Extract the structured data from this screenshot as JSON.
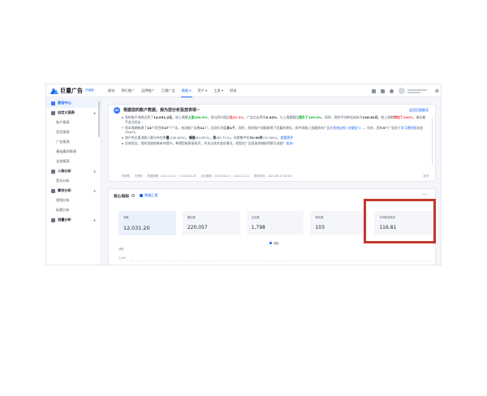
{
  "header": {
    "logo_text": "巨量广告",
    "logo_badge": "升级版",
    "nav": [
      {
        "label": "概览",
        "active": false
      },
      {
        "label": "预行推广",
        "active": false
      },
      {
        "label": "品牌推广",
        "active": false
      },
      {
        "label": "巨量广告",
        "active": false
      },
      {
        "label": "数据 ▾",
        "active": true
      },
      {
        "label": "资产 ▾",
        "active": false
      },
      {
        "label": "工具 ▾",
        "active": false
      },
      {
        "label": "财务",
        "active": false
      }
    ],
    "icons": [
      "calendar-icon",
      "message-icon",
      "help-icon",
      "avatar",
      "settings-icon"
    ]
  },
  "sidebar": {
    "items": [
      {
        "label": "报告中心",
        "type": "head-active"
      },
      {
        "label": "自定义报表",
        "type": "head"
      },
      {
        "label": "账户报表",
        "type": "sub"
      },
      {
        "label": "项目报表",
        "type": "sub"
      },
      {
        "label": "广告报表",
        "type": "sub"
      },
      {
        "label": "基础素材报表",
        "type": "sub"
      },
      {
        "label": "全部报表",
        "type": "sub"
      },
      {
        "label": "人群分析",
        "type": "head"
      },
      {
        "label": "受众分析",
        "type": "sub"
      },
      {
        "label": "素材分析",
        "type": "head"
      },
      {
        "label": "视频分析",
        "type": "sub"
      },
      {
        "label": "标题分析",
        "type": "sub"
      },
      {
        "label": "流量分析",
        "type": "head"
      }
    ]
  },
  "ai_card": {
    "logo": "AI",
    "title": "根据您的账户数据，我为您分析投放表现~",
    "link": "返回旧版解读",
    "b1": {
      "p1": "您的账户消耗达到了",
      "v1": "12,031.2元",
      "p2": "，较上周期",
      "v2": "上涨100.0%",
      "p3": "，但与同行相比",
      "v3": "低33.3%",
      "p4": "。广告点击率为",
      "v4": "0.42%",
      "p5": "，与上周期相比",
      "v5": "提升了100.0%",
      "p6": "，同时，您的平均转化成本为",
      "v6": "116.81元",
      "p7": "，较上周期",
      "v7": "增加了100%",
      "p8": "，建议着手关注优化~"
    },
    "b2": {
      "p1": "您本周期新建了",
      "v1": "13",
      "p2": "个项目和",
      "v2": "17",
      "p3": "个广告，有消耗广告数",
      "v3": "11",
      "p4": "个，比同行均值",
      "v4": "多1个",
      "p5": "。同时，您的账户消耗取得了显著的增长，其中消耗上涨最多的广告为",
      "v5": "系统自投+关键定·4...",
      "p6": "，另外，您有",
      "v6": "3",
      "p7": "个广告处于",
      "v7": "学习期失败",
      "p8": "状态(Top3)。"
    },
    "b3": {
      "p1": "账户的主要消耗人群分布在",
      "v1": "少量",
      "p2": "(100.00%)，",
      "v2": "福建",
      "p3": "(64.82%)，",
      "v3": "男",
      "p4": "(62.71%)，年龄集中在",
      "v4": "31-40岁",
      "p5": "(42.96%)，",
      "v5": "查看更多"
    },
    "b4": {
      "p1": "总体而言，您的投放效果有待提升，希望您能再接再厉，并关注成本变化情况，祝您在广告投放领域取得更大成就！",
      "v1": "加油!"
    },
    "footer": {
      "like": "有帮助",
      "dislike": "无帮助",
      "range1": "数据周期：2024-07-01 ~ 2024-08-26",
      "range2": "对比周期：2024-06-12 ~ 2024-12-11",
      "time": "更新时间：2024-08-27 09:00",
      "right": "反馈"
    }
  },
  "core": {
    "title": "核心指标",
    "checkbox_label": "数据汇报",
    "metrics": [
      {
        "label": "消耗",
        "value": "12,031.20"
      },
      {
        "label": "展示数",
        "value": "220,057"
      },
      {
        "label": "点击数",
        "value": "1,798"
      },
      {
        "label": "转化数",
        "value": "103"
      },
      {
        "label": "平均转化成本",
        "value": "116.81"
      }
    ],
    "legend": "消耗",
    "y_ticks": [
      "消耗",
      "2,000"
    ]
  },
  "colors": {
    "accent": "#1d64f2",
    "highlight": "#c0392b",
    "up_red": "#f53f3f",
    "up_green": "#00b42a"
  }
}
